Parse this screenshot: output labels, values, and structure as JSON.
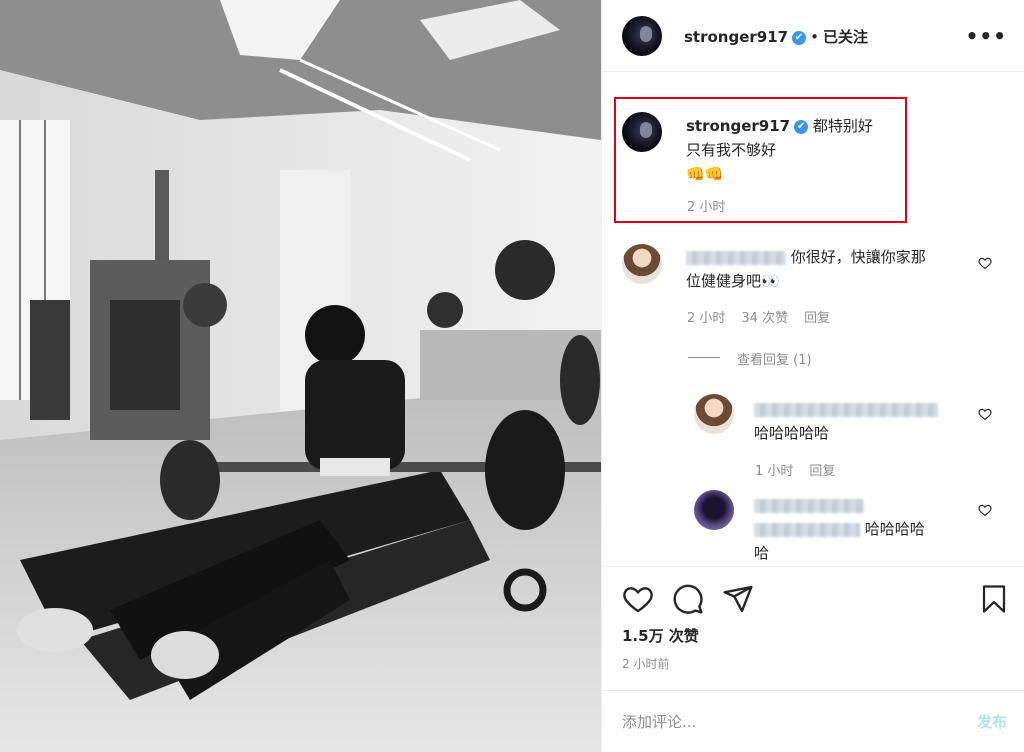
{
  "post": {
    "username": "stronger917",
    "verified_mark": "✔",
    "dot": "•",
    "follow_status": "已关注",
    "more_label": "•••"
  },
  "caption": {
    "username": "stronger917",
    "line1": "都特别好",
    "line2": "只有我不够好",
    "emoji": "👊👊",
    "time": "2 小时"
  },
  "comments": [
    {
      "text_line1": "你很好，快讓你家那",
      "text_line2": "位健健身吧👀",
      "time": "2 小时",
      "likes": "34 次赞",
      "reply_label": "回复",
      "view_replies": "查看回复 (1)"
    },
    {
      "text": "哈哈哈哈哈",
      "time": "1 小时",
      "reply_label": "回复"
    },
    {
      "text_line1": "哈哈哈哈",
      "text_line2": "哈"
    }
  ],
  "stats": {
    "likes": "1.5万 次赞",
    "time": "2 小时前"
  },
  "add_comment": {
    "placeholder": "添加评论...",
    "post_label": "发布"
  },
  "colors": {
    "highlight_box": "#e0001a",
    "verified": "#3897f0",
    "post_button": "#b2dffc"
  },
  "icons": [
    "heart-icon",
    "comment-icon",
    "share-icon",
    "bookmark-icon",
    "more-icon",
    "verified-icon"
  ]
}
